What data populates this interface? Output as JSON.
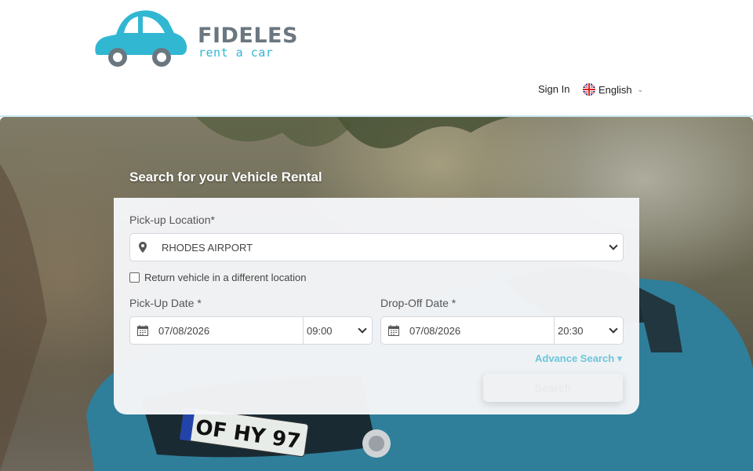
{
  "brand": {
    "name": "FIDELES",
    "tagline": "rent a car"
  },
  "nav": {
    "sign_in": "Sign In",
    "language": "English"
  },
  "hero": {
    "plate_text": "OF HY 97"
  },
  "search_form": {
    "title": "Search for your Vehicle Rental",
    "pickup_location": {
      "label": "Pick-up Location*",
      "value": "RHODES AIRPORT"
    },
    "return_different": {
      "label": "Return vehicle in a different location",
      "checked": false
    },
    "pickup_date": {
      "label": "Pick-Up Date *",
      "date": "07/08/2026",
      "time": "09:00"
    },
    "dropoff_date": {
      "label": "Drop-Off Date *",
      "date": "07/08/2026",
      "time": "20:30"
    },
    "advance_search": "Advance Search ▾",
    "search_button": "Search"
  },
  "colors": {
    "accent": "#32b7d3",
    "logo_gray": "#6b7780",
    "link": "#6ec5d8"
  }
}
